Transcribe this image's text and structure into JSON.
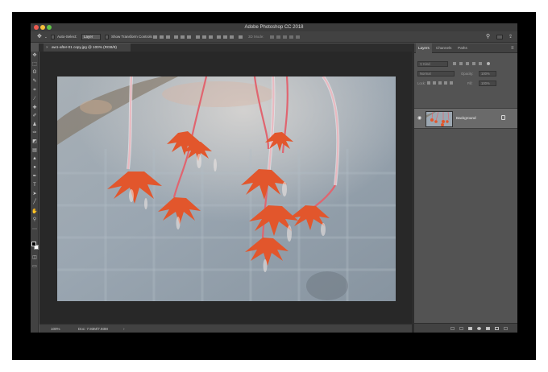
{
  "app": {
    "title": "Adobe Photoshop CC 2018",
    "traffic_colors": [
      "#ee5b50",
      "#f5be3b",
      "#5fc548"
    ]
  },
  "options_bar": {
    "auto_select_label": "Auto-Select:",
    "auto_select_value": "Layer",
    "show_transform_label": "Show Transform Controls",
    "mode_label": "3D Mode:"
  },
  "document": {
    "tab_title": "aw1-after-01 copy.jpg @ 100% (RGB/8)",
    "tab_close": "×"
  },
  "tools": [
    {
      "name": "move-tool-icon",
      "glyph": "✥"
    },
    {
      "name": "marquee-tool-icon",
      "glyph": "⬚"
    },
    {
      "name": "lasso-tool-icon",
      "glyph": "ʘ"
    },
    {
      "name": "quick-select-tool-icon",
      "glyph": "✎"
    },
    {
      "name": "crop-tool-icon",
      "glyph": "⌗"
    },
    {
      "name": "eyedropper-tool-icon",
      "glyph": "⁄"
    },
    {
      "name": "healing-brush-tool-icon",
      "glyph": "✚"
    },
    {
      "name": "brush-tool-icon",
      "glyph": "✐"
    },
    {
      "name": "clone-stamp-tool-icon",
      "glyph": "♟"
    },
    {
      "name": "history-brush-tool-icon",
      "glyph": "✑"
    },
    {
      "name": "eraser-tool-icon",
      "glyph": "◩"
    },
    {
      "name": "gradient-tool-icon",
      "glyph": "▤"
    },
    {
      "name": "blur-tool-icon",
      "glyph": "▲"
    },
    {
      "name": "dodge-tool-icon",
      "glyph": "●"
    },
    {
      "name": "pen-tool-icon",
      "glyph": "✒"
    },
    {
      "name": "type-tool-icon",
      "glyph": "T"
    },
    {
      "name": "path-select-tool-icon",
      "glyph": "➤"
    },
    {
      "name": "shape-tool-icon",
      "glyph": "╱"
    },
    {
      "name": "hand-tool-icon",
      "glyph": "✋"
    },
    {
      "name": "zoom-tool-icon",
      "glyph": "⚲"
    },
    {
      "name": "more-tools-icon",
      "glyph": "⋯"
    }
  ],
  "status": {
    "zoom": "100%",
    "doc_size": "Doc: 7.93M/7.93M",
    "arrow": "›"
  },
  "panel": {
    "tabs": [
      "Layers",
      "Channels",
      "Paths"
    ],
    "filter_label": "Kind",
    "blend_mode": "Normal",
    "opacity_label": "Opacity:",
    "opacity_value": "100%",
    "lock_label": "Lock:",
    "fill_label": "Fill:",
    "fill_value": "100%",
    "layer_name": "Background"
  }
}
